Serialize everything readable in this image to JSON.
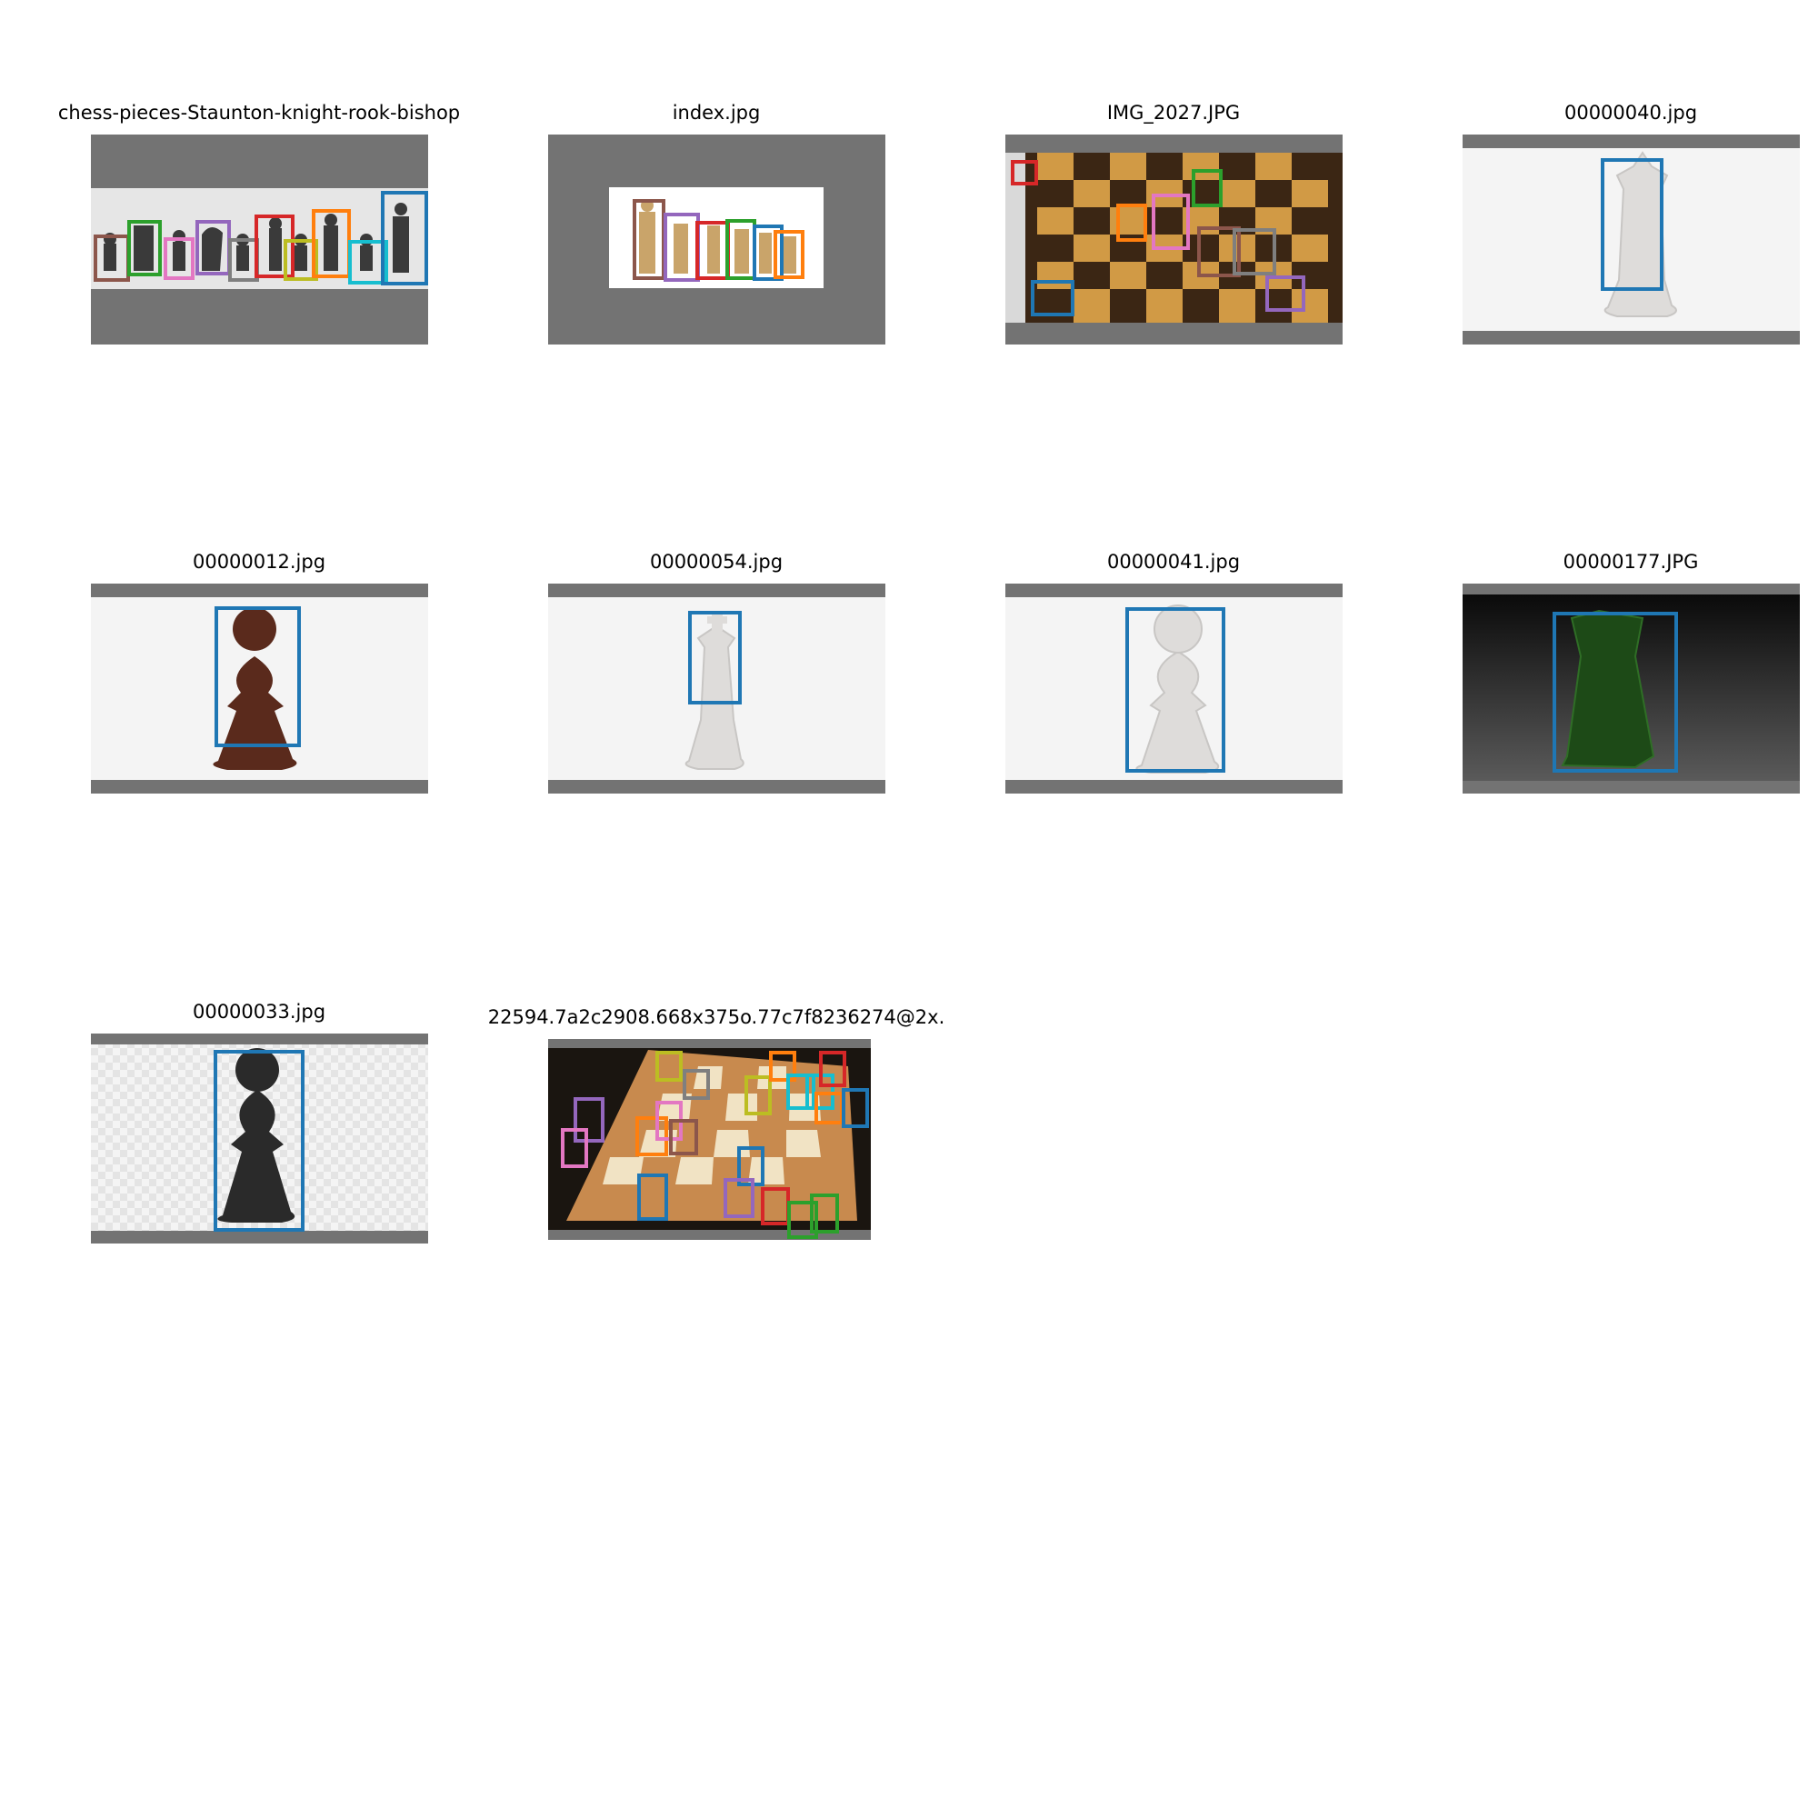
{
  "figure": {
    "background": "#ffffff",
    "pad_color": "#737373",
    "panels": [
      {
        "title": "chess-pieces-Staunton-knight-rook-bishop",
        "box_count": 11
      },
      {
        "title": "index.jpg",
        "box_count": 6
      },
      {
        "title": "IMG_2027.JPG",
        "box_count": 8
      },
      {
        "title": "00000040.jpg",
        "box_count": 1
      },
      {
        "title": "00000012.jpg",
        "box_count": 1
      },
      {
        "title": "00000054.jpg",
        "box_count": 1
      },
      {
        "title": "00000041.jpg",
        "box_count": 1
      },
      {
        "title": "00000177.JPG",
        "box_count": 1
      },
      {
        "title": "00000033.jpg",
        "box_count": 1
      },
      {
        "title": "22594.7a2c2908.668x375o.77c7f8236274@2x.",
        "box_count": 24
      }
    ],
    "box_palette": [
      "#1f77b4",
      "#ff7f0e",
      "#2ca02c",
      "#d62728",
      "#9467bd",
      "#8c564b",
      "#e377c2",
      "#7f7f7f",
      "#bcbd22",
      "#17becf"
    ],
    "icons": [
      "chess-piece-photo",
      "bounding-box"
    ]
  }
}
